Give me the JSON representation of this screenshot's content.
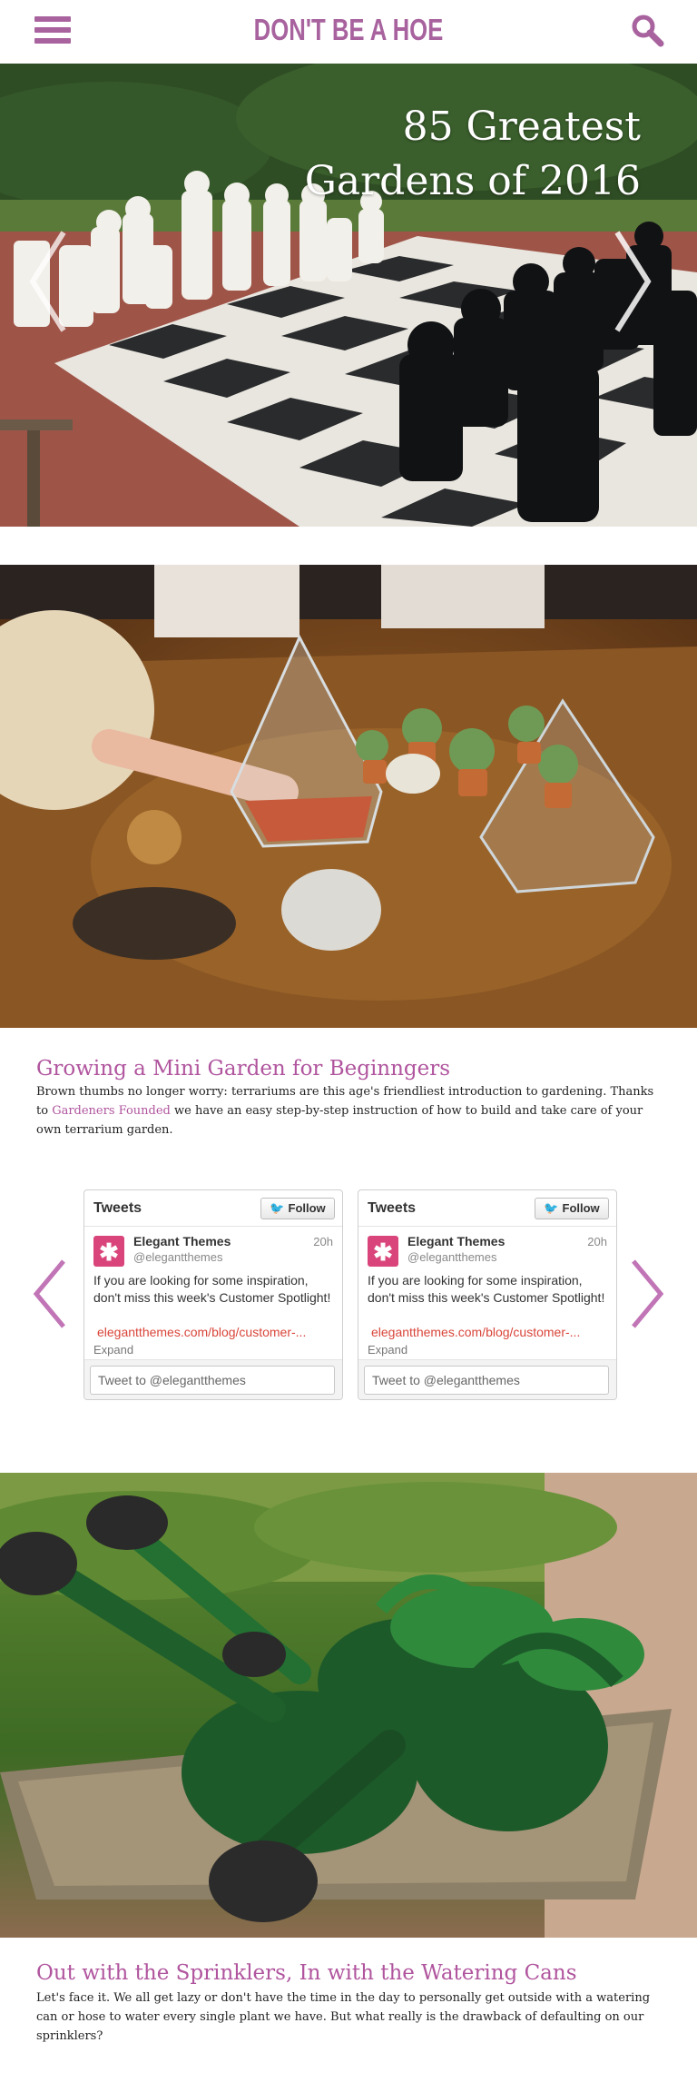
{
  "header": {
    "logo": "DON'T BE A HOE"
  },
  "hero": {
    "title": "85 Greatest Gardens of 2016"
  },
  "post1": {
    "title": "Growing a Mini Garden for Beginngers",
    "body_part1": "Brown thumbs no longer worry: terrariums are this age's friendliest introduction to gardening. Thanks to ",
    "link": "Gardeners Founded",
    "body_part2": " we have an easy step-by-step instruction of how to build and take care of your own terrarium garden."
  },
  "tweets": [
    {
      "header": "Tweets",
      "follow": "Follow",
      "name": "Elegant Themes",
      "handle": "@elegantthemes",
      "time": "20h",
      "text": "If you are looking for some inspiration, don't miss this week's Customer Spotlight!",
      "link": "elegantthemes.com/blog/customer-...",
      "expand": "Expand",
      "input_placeholder": "Tweet to @elegantthemes"
    },
    {
      "header": "Tweets",
      "follow": "Follow",
      "name": "Elegant Themes",
      "handle": "@elegantthemes",
      "time": "20h",
      "text": "If you are looking for some inspiration, don't miss this week's Customer Spotlight!",
      "link": "elegantthemes.com/blog/customer-...",
      "expand": "Expand",
      "input_placeholder": "Tweet to @elegantthemes"
    }
  ],
  "post2": {
    "title": "Out with the Sprinklers, In with the Watering Cans",
    "body": "Let's face it. We all get lazy or don't have the time in the day to personally get outside with a watering can or hose to water every single plant we have. But what really is the drawback of defaulting on our sprinklers?"
  },
  "colors": {
    "brand": "#a8639f",
    "link": "#b0559e",
    "tweet_link": "#d9453a",
    "avatar": "#d9457a"
  },
  "icons": {
    "menu": "hamburger-icon",
    "search": "search-icon",
    "prev": "chevron-left-icon",
    "next": "chevron-right-icon"
  }
}
